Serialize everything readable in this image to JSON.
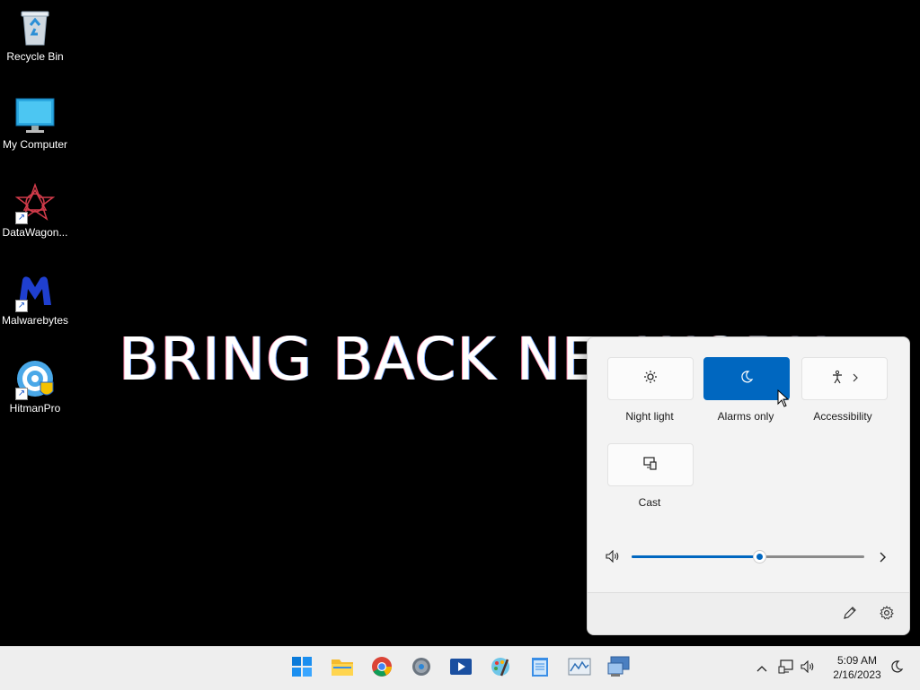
{
  "desktop": {
    "wallpaper_text": "BRING BACK NETWORK",
    "icons": [
      {
        "label": "Recycle Bin",
        "icon": "recycle-bin-icon"
      },
      {
        "label": "My Computer",
        "icon": "monitor-icon"
      },
      {
        "label": "DataWagon...",
        "icon": "datawagon-icon"
      },
      {
        "label": "Malwarebytes",
        "icon": "malwarebytes-icon"
      },
      {
        "label": "HitmanPro",
        "icon": "hitmanpro-icon"
      }
    ]
  },
  "quick_settings": {
    "tiles": [
      {
        "label": "Night light",
        "icon": "brightness-icon",
        "active": false
      },
      {
        "label": "Alarms only",
        "icon": "moon-icon",
        "active": true
      },
      {
        "label": "Accessibility",
        "icon": "accessibility-icon",
        "active": false
      },
      {
        "label": "Cast",
        "icon": "cast-icon",
        "active": false
      }
    ],
    "volume_level": 0.55,
    "accent_color": "#0067c0"
  },
  "taskbar": {
    "apps": [
      "start-icon",
      "file-explorer-icon",
      "chrome-icon",
      "settings-icon",
      "media-player-icon",
      "paint-icon",
      "notepad-icon",
      "performance-monitor-icon",
      "remote-desktop-icon"
    ],
    "time": "5:09 AM",
    "date": "2/16/2023"
  }
}
